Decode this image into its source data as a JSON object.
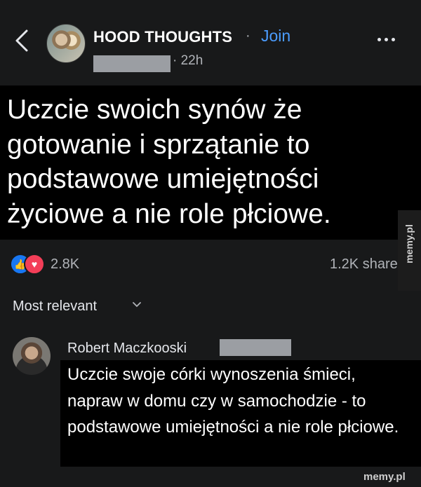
{
  "header": {
    "page_name": "HOOD THOUGHTS",
    "separator": "·",
    "join_label": "Join",
    "time": "· 22h",
    "icons": [
      "back-chevron-icon",
      "more-dots-icon"
    ]
  },
  "post": {
    "text": "Uczcie swoich synów że gotowanie i sprzątanie to podstawowe umiejętności życiowe a nie role płciowe."
  },
  "stats": {
    "reaction_count": "2.8K",
    "shares": "1.2K shares",
    "reaction_icons": [
      "like-icon",
      "love-icon"
    ]
  },
  "comments_filter": {
    "label": "Most relevant"
  },
  "comment": {
    "author": "Robert Maczkooski",
    "text": "Uczcie swoje córki wynoszenia śmieci, napraw w domu czy w samochodzie - to podstawowe umiejętności a nie role płciowe."
  },
  "watermark": {
    "side": "memy.pl",
    "bottom": "memy.pl"
  },
  "colors": {
    "background": "#18191a",
    "accent": "#4b9cff",
    "like": "#1877f2",
    "love": "#f33e58"
  }
}
